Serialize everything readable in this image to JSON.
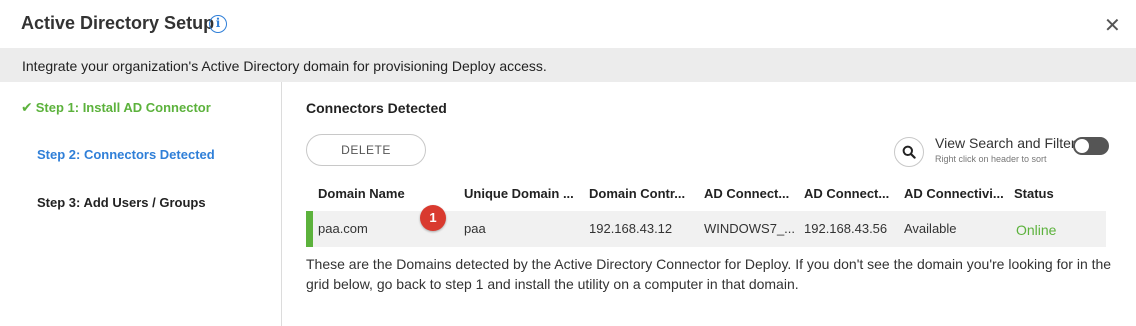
{
  "header": {
    "title": "Active Directory Setup",
    "info_icon": "info-icon",
    "close_icon": "close-icon",
    "close_glyph": "✕"
  },
  "banner": {
    "text": "Integrate your organization's Active Directory domain for provisioning Deploy access."
  },
  "sidebar": {
    "steps": [
      {
        "label": "Step 1: Install AD Connector",
        "state": "complete",
        "icon": "check-icon"
      },
      {
        "label": "Step 2: Connectors Detected",
        "state": "active"
      },
      {
        "label": "Step 3: Add Users / Groups",
        "state": "pending"
      }
    ]
  },
  "main": {
    "section_title": "Connectors Detected",
    "delete_label": "DELETE",
    "search_icon": "search-icon",
    "filter_label": "View Search and Filter",
    "filter_hint": "Right click on header to sort",
    "filter_enabled": false,
    "table": {
      "columns": [
        "Domain Name",
        "Unique Domain ...",
        "Domain Contr...",
        "AD Connect...",
        "AD Connect...",
        "AD Connectivi...",
        "Status"
      ],
      "rows": [
        {
          "domain_name": "paa.com",
          "unique_domain": "paa",
          "domain_controller": "192.168.43.12",
          "ad_connector_name": "WINDOWS7_...",
          "ad_connector_ip": "192.168.43.56",
          "ad_connectivity": "Available",
          "status": "Online",
          "badge": "1"
        }
      ]
    },
    "footnote": "These are the Domains detected by the Active Directory Connector for Deploy. If you don't see the domain you're looking for in the grid below, go back to step 1 and install the utility on a computer in that domain."
  },
  "colors": {
    "accent_green": "#5cb23c",
    "accent_blue": "#2f7fd8",
    "badge_red": "#d93a2f",
    "banner_bg": "#ececec"
  }
}
